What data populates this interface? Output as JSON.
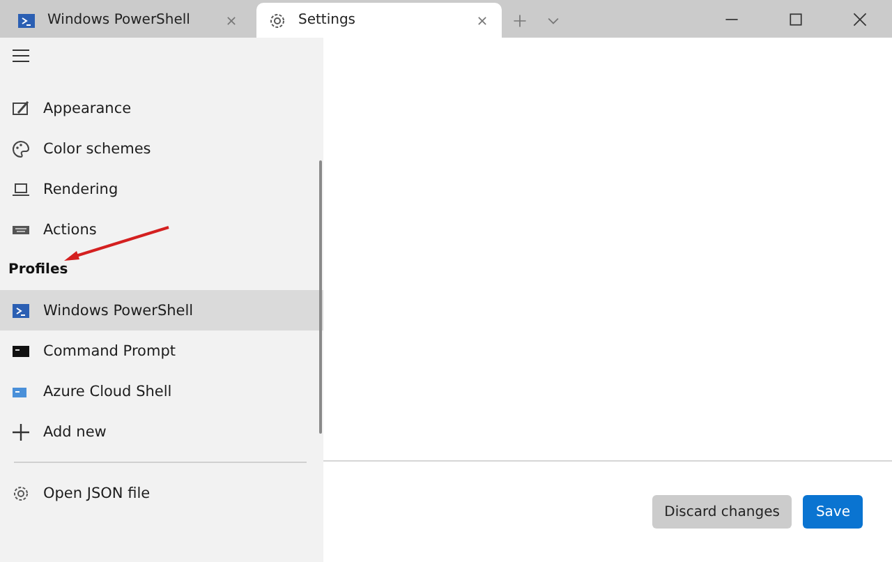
{
  "tabs": [
    {
      "title": "Windows PowerShell",
      "kind": "shell",
      "selected": false
    },
    {
      "title": "Settings",
      "kind": "settings",
      "selected": true
    }
  ],
  "sidebar": {
    "items": [
      {
        "label": "Appearance",
        "kind": "appearance",
        "selected": false
      },
      {
        "label": "Color schemes",
        "kind": "palette",
        "selected": false
      },
      {
        "label": "Rendering",
        "kind": "laptop",
        "selected": false
      },
      {
        "label": "Actions",
        "kind": "keyboard",
        "selected": false
      }
    ],
    "profiles_header": "Profiles",
    "profiles": [
      {
        "label": "Windows PowerShell",
        "kind": "shell",
        "selected": true
      },
      {
        "label": "Command Prompt",
        "kind": "cmd",
        "selected": false
      },
      {
        "label": "Azure Cloud Shell",
        "kind": "azure",
        "selected": false
      },
      {
        "label": "Add new",
        "kind": "plus",
        "selected": false
      }
    ],
    "footer_item": {
      "label": "Open JSON file",
      "kind": "gear"
    }
  },
  "buttons": [
    {
      "label": "Discard changes",
      "kind": "secondary"
    },
    {
      "label": "Save",
      "kind": "primary"
    }
  ]
}
